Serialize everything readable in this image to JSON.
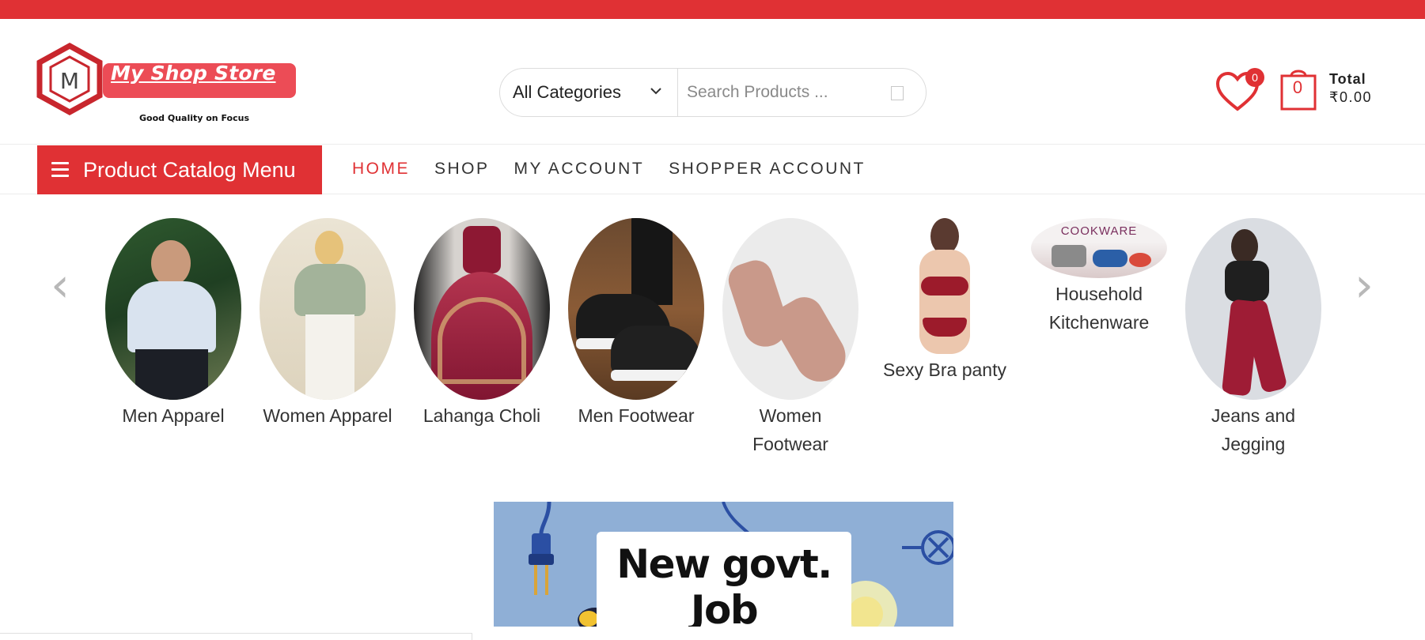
{
  "colors": {
    "accent": "#e03134",
    "text": "#333333",
    "banner_bg": "#8fafd6"
  },
  "logo": {
    "letter": "M",
    "brand": "My Shop Store",
    "tagline": "Good Quality on Focus"
  },
  "search": {
    "category": "All Categories",
    "placeholder": "Search Products ...",
    "icon": "search-icon"
  },
  "header": {
    "wishlist_count": "0",
    "cart_count": "0",
    "total_label": "Total",
    "total_amount": "₹0.00"
  },
  "nav": {
    "catalog_label": "Product Catalog Menu",
    "links": [
      "HOME",
      "SHOP",
      "MY ACCOUNT",
      "SHOPPER ACCOUNT"
    ],
    "active": "HOME"
  },
  "carousel": {
    "prev": "‹",
    "next": "›",
    "items": [
      {
        "name": "Men Apparel"
      },
      {
        "name": "Women Apparel"
      },
      {
        "name": "Lahanga Choli"
      },
      {
        "name": "Men Footwear"
      },
      {
        "name": "Women Footwear"
      },
      {
        "name": "Sexy Bra panty"
      },
      {
        "name": "Household Kitchenware",
        "thumb_text": "COOKWARE"
      },
      {
        "name": "Jeans and Jegging"
      }
    ]
  },
  "banner": {
    "headline": "New govt. Job"
  }
}
